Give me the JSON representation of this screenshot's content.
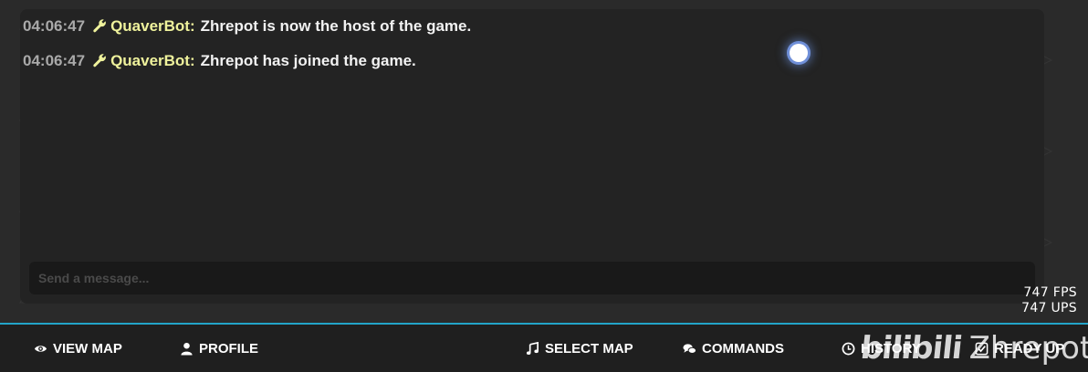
{
  "chat": {
    "messages": [
      {
        "time": "04:06:47",
        "user": "QuaverBot:",
        "text": "Zhrepot is now the host of the game."
      },
      {
        "time": "04:06:47",
        "user": "QuaverBot:",
        "text": "Zhrepot has joined the game."
      }
    ],
    "input_placeholder": "Send a message..."
  },
  "perf": {
    "fps": "747 FPS",
    "ups": "747 UPS"
  },
  "nav": {
    "view_map": "VIEW MAP",
    "profile": "PROFILE",
    "select_map": "SELECT MAP",
    "commands": "COMMANDS",
    "history": "HISTORY",
    "ready_up": "READY UP"
  },
  "watermark": {
    "logo": "bilibili",
    "name": "Zhrepot"
  },
  "colors": {
    "accent": "#22a4c8",
    "bot_name": "#eff29c",
    "timestamp": "#a9a9a9",
    "panel_bg": "#232323"
  },
  "icons": {
    "message_badge": "wrench-icon",
    "view_map": "eye-icon",
    "profile": "user-icon",
    "select_map": "music-note-icon",
    "commands": "chat-bubbles-icon",
    "history": "clock-icon",
    "ready_up": "checkbox-icon"
  }
}
